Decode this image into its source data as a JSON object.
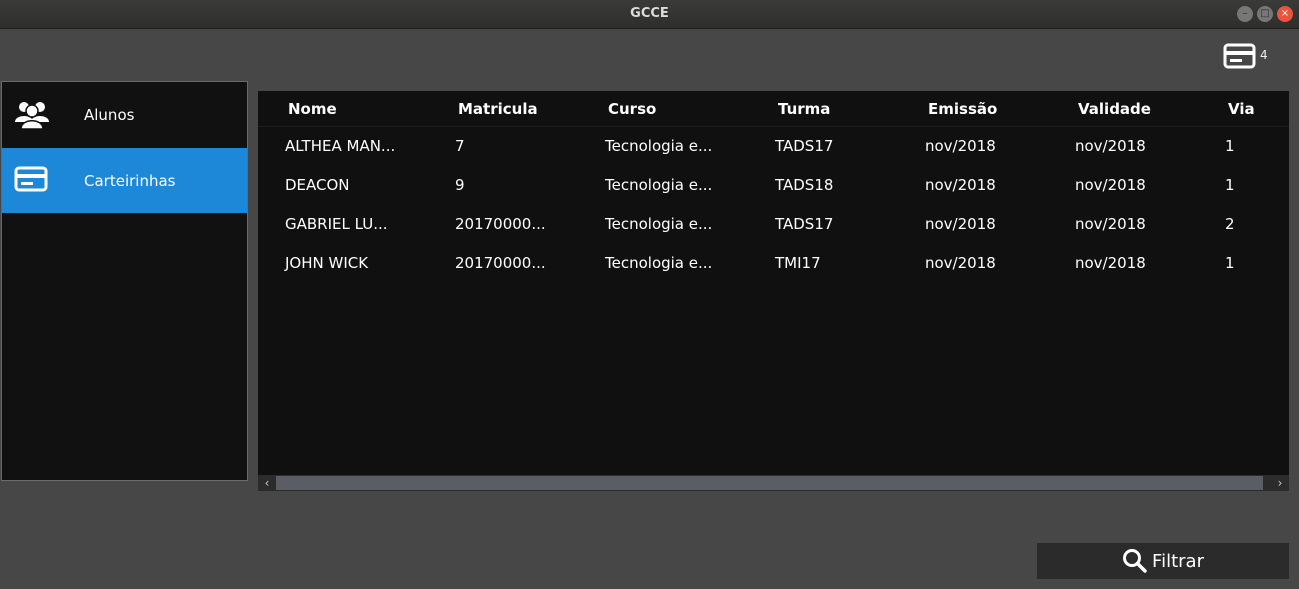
{
  "window": {
    "title": "GCCE"
  },
  "header": {
    "card_count": "4",
    "card_icon": "card-icon"
  },
  "sidebar": {
    "items": [
      {
        "label": "Alunos",
        "icon": "users-icon",
        "active": false
      },
      {
        "label": "Carteirinhas",
        "icon": "card-icon",
        "active": true
      }
    ]
  },
  "table": {
    "columns": [
      "Nome",
      "Matricula",
      "Curso",
      "Turma",
      "Emissão",
      "Validade",
      "Via"
    ],
    "rows": [
      [
        "ALTHEA MAN...",
        "7",
        "Tecnologia e...",
        "TADS17",
        "nov/2018",
        "nov/2018",
        "1"
      ],
      [
        "DEACON",
        "9",
        "Tecnologia e...",
        "TADS18",
        "nov/2018",
        "nov/2018",
        "1"
      ],
      [
        "GABRIEL LU...",
        "20170000...",
        "Tecnologia e...",
        "TADS17",
        "nov/2018",
        "nov/2018",
        "2"
      ],
      [
        "JOHN WICK",
        "20170000...",
        "Tecnologia e...",
        "TMI17",
        "nov/2018",
        "nov/2018",
        "1"
      ]
    ]
  },
  "footer": {
    "filter_label": "Filtrar",
    "filter_icon": "search-icon"
  },
  "colors": {
    "accent": "#1e88d8",
    "background": "#474747",
    "panel": "#111111"
  }
}
